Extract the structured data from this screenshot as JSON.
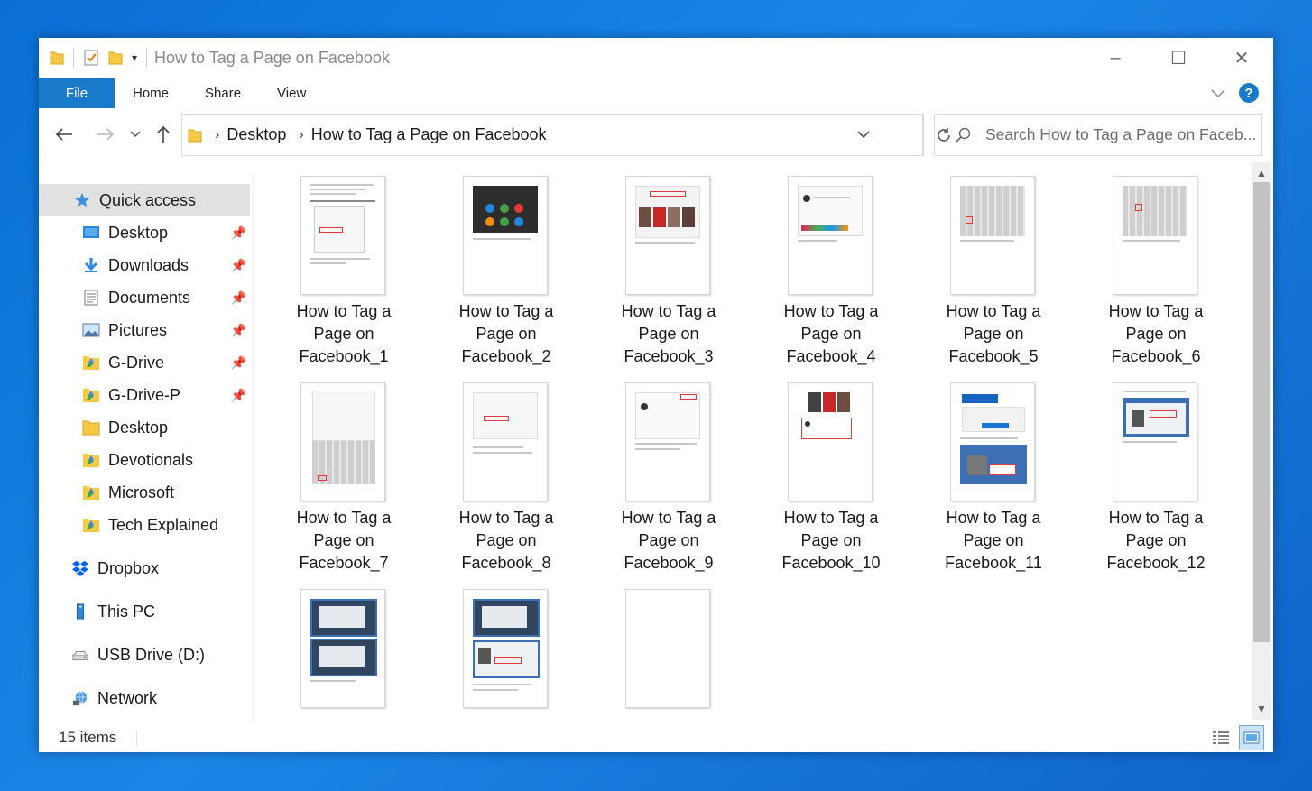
{
  "window": {
    "title": "How to Tag a Page on Facebook",
    "controls": {
      "minimize": "–",
      "maximize": "☐",
      "close": "✕"
    }
  },
  "ribbon": {
    "file_label": "File",
    "tabs": [
      "Home",
      "Share",
      "View"
    ],
    "help_label": "?"
  },
  "address": {
    "segments": [
      "Desktop",
      "How to Tag a Page on Facebook"
    ]
  },
  "search": {
    "placeholder": "Search How to Tag a Page on Faceb..."
  },
  "sidebar": {
    "items": [
      {
        "label": "Quick access",
        "icon": "star-icon",
        "pinned": false
      },
      {
        "label": "Desktop",
        "icon": "desktop-icon",
        "pinned": true
      },
      {
        "label": "Downloads",
        "icon": "download-icon",
        "pinned": true
      },
      {
        "label": "Documents",
        "icon": "documents-icon",
        "pinned": true
      },
      {
        "label": "Pictures",
        "icon": "pictures-icon",
        "pinned": true
      },
      {
        "label": "G-Drive",
        "icon": "gdrive-folder-icon",
        "pinned": true
      },
      {
        "label": "G-Drive-P",
        "icon": "gdrive-folder-icon",
        "pinned": true
      },
      {
        "label": "Desktop",
        "icon": "folder-icon",
        "pinned": false
      },
      {
        "label": "Devotionals",
        "icon": "gdrive-folder-icon",
        "pinned": false
      },
      {
        "label": "Microsoft",
        "icon": "gdrive-folder-icon",
        "pinned": false
      },
      {
        "label": "Tech Explained",
        "icon": "gdrive-folder-icon",
        "pinned": false
      },
      {
        "label": "Dropbox",
        "icon": "dropbox-icon",
        "pinned": false
      },
      {
        "label": "This PC",
        "icon": "this-pc-icon",
        "pinned": false
      },
      {
        "label": "USB Drive (D:)",
        "icon": "usb-drive-icon",
        "pinned": false
      },
      {
        "label": "Network",
        "icon": "network-icon",
        "pinned": false
      }
    ]
  },
  "files": [
    {
      "line1": "How to Tag a",
      "line2": "Page on",
      "line3": "Facebook_1"
    },
    {
      "line1": "How to Tag a",
      "line2": "Page on",
      "line3": "Facebook_2"
    },
    {
      "line1": "How to Tag a",
      "line2": "Page on",
      "line3": "Facebook_3"
    },
    {
      "line1": "How to Tag a",
      "line2": "Page on",
      "line3": "Facebook_4"
    },
    {
      "line1": "How to Tag a",
      "line2": "Page on",
      "line3": "Facebook_5"
    },
    {
      "line1": "How to Tag a",
      "line2": "Page on",
      "line3": "Facebook_6"
    },
    {
      "line1": "How to Tag a",
      "line2": "Page on",
      "line3": "Facebook_7"
    },
    {
      "line1": "How to Tag a",
      "line2": "Page on",
      "line3": "Facebook_8"
    },
    {
      "line1": "How to Tag a",
      "line2": "Page on",
      "line3": "Facebook_9"
    },
    {
      "line1": "How to Tag a",
      "line2": "Page on",
      "line3": "Facebook_10"
    },
    {
      "line1": "How to Tag a",
      "line2": "Page on",
      "line3": "Facebook_11"
    },
    {
      "line1": "How to Tag a",
      "line2": "Page on",
      "line3": "Facebook_12"
    },
    {
      "line1": "",
      "line2": "",
      "line3": ""
    },
    {
      "line1": "",
      "line2": "",
      "line3": ""
    },
    {
      "line1": "",
      "line2": "",
      "line3": ""
    }
  ],
  "status": {
    "item_count": "15 items"
  },
  "colors": {
    "accent": "#1979ca",
    "selection": "#e1e1e1"
  }
}
